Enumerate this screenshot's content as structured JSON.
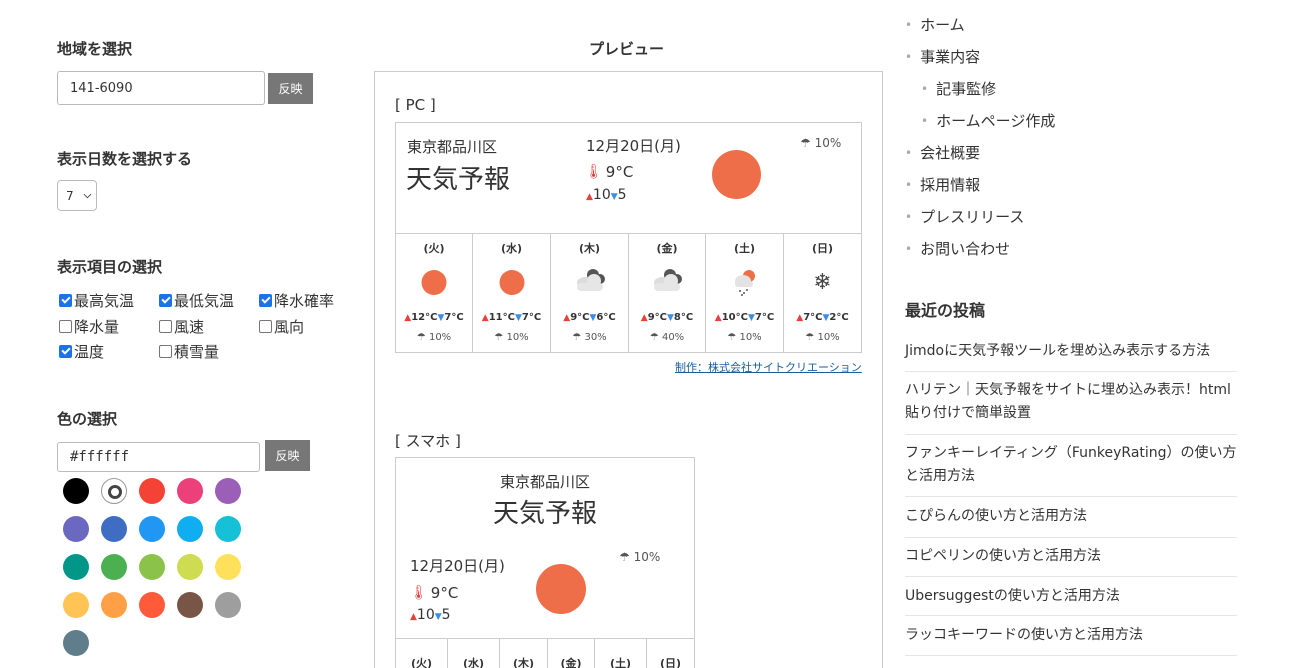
{
  "settings": {
    "region_heading": "地域を選択",
    "region_value": "141-6090",
    "apply_label": "反映",
    "days_heading": "表示日数を選択する",
    "days_value": "7",
    "items_heading": "表示項目の選択",
    "items": [
      {
        "label": "最高気温",
        "checked": true
      },
      {
        "label": "最低気温",
        "checked": true
      },
      {
        "label": "降水確率",
        "checked": true
      },
      {
        "label": "降水量",
        "checked": false
      },
      {
        "label": "風速",
        "checked": false
      },
      {
        "label": "風向",
        "checked": false
      },
      {
        "label": "温度",
        "checked": true
      },
      {
        "label": "積雪量",
        "checked": false
      }
    ],
    "color_heading": "色の選択",
    "color_value": "#ffffff",
    "swatches": [
      "#000000",
      "#ffffff",
      "#f44336",
      "#ec407a",
      "#9c5fb8",
      "#6a68c0",
      "#3f6dc4",
      "#2196f3",
      "#10aef0",
      "#16c0d6",
      "#009688",
      "#4caf50",
      "#8bc34a",
      "#cddc50",
      "#ffe05a",
      "#ffc453",
      "#ffa046",
      "#ff5a3a",
      "#795548",
      "#9e9e9e",
      "#607d8b"
    ]
  },
  "preview": {
    "title": "プレビュー",
    "pc_label": "[ PC ]",
    "sp_label": "[ スマホ ]",
    "location": "東京都品川区",
    "forecast_title": "天気予報",
    "date": "12月20日(月)",
    "temp": "9°C",
    "high": "10",
    "low": "5",
    "rain": "10%",
    "days": [
      {
        "name": "(火)",
        "icon": "sun-icon",
        "high": "12°C",
        "low": "7°C",
        "rain": "10%"
      },
      {
        "name": "(水)",
        "icon": "sun-icon",
        "high": "11°C",
        "low": "7°C",
        "rain": "10%"
      },
      {
        "name": "(木)",
        "icon": "cloud-icon",
        "high": "9°C",
        "low": "6°C",
        "rain": "30%"
      },
      {
        "name": "(金)",
        "icon": "cloud-icon",
        "high": "9°C",
        "low": "8°C",
        "rain": "40%"
      },
      {
        "name": "(土)",
        "icon": "sleet-icon",
        "high": "10°C",
        "low": "7°C",
        "rain": "10%"
      },
      {
        "name": "(日)",
        "icon": "snow-icon",
        "high": "7°C",
        "low": "2°C",
        "rain": "10%"
      }
    ],
    "credit": "制作：株式会社サイトクリエーション"
  },
  "sidebar": {
    "nav": [
      {
        "label": "ホーム",
        "indent": 0
      },
      {
        "label": "事業内容",
        "indent": 0
      },
      {
        "label": "記事監修",
        "indent": 1
      },
      {
        "label": "ホームページ作成",
        "indent": 1
      },
      {
        "label": "会社概要",
        "indent": 0
      },
      {
        "label": "採用情報",
        "indent": 0
      },
      {
        "label": "プレスリリース",
        "indent": 0
      },
      {
        "label": "お問い合わせ",
        "indent": 0
      }
    ],
    "recent_heading": "最近の投稿",
    "posts": [
      "Jimdoに天気予報ツールを埋め込み表示する方法",
      "ハリテン｜天気予報をサイトに埋め込み表示！html貼り付けで簡単設置",
      "ファンキーレイティング（FunkeyRating）の使い方と活用方法",
      "こぴらんの使い方と活用方法",
      "コピペリンの使い方と活用方法",
      "Ubersuggestの使い方と活用方法",
      "ラッコキーワードの使い方と活用方法"
    ]
  },
  "colors": {
    "sun": "#ee6e4a",
    "up_arrow": "#e8403a",
    "down_arrow": "#3a8ee8",
    "button": "#777777",
    "link": "#1a5e99"
  }
}
